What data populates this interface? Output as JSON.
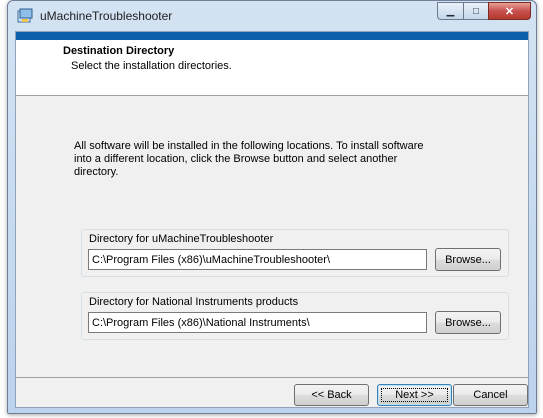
{
  "window": {
    "title": "uMachineTroubleshooter",
    "minimize_glyph": "▁",
    "maximize_glyph": "□",
    "close_glyph": "✕"
  },
  "header": {
    "title": "Destination Directory",
    "subtitle": "Select the installation directories."
  },
  "body": {
    "info_text": "All software will be installed in the following locations. To install software into a different location, click the Browse button and select another directory."
  },
  "directories": [
    {
      "label": "Directory for uMachineTroubleshooter",
      "path": "C:\\Program Files (x86)\\uMachineTroubleshooter\\",
      "browse_label": "Browse..."
    },
    {
      "label": "Directory for National Instruments products",
      "path": "C:\\Program Files (x86)\\National Instruments\\",
      "browse_label": "Browse..."
    }
  ],
  "footer": {
    "back_label": "<< Back",
    "next_label": "Next >>",
    "cancel_label": "Cancel"
  },
  "colors": {
    "banner": "#0c5faa",
    "dialog_bg": "#f0f0f0",
    "close_button": "#c75050"
  }
}
